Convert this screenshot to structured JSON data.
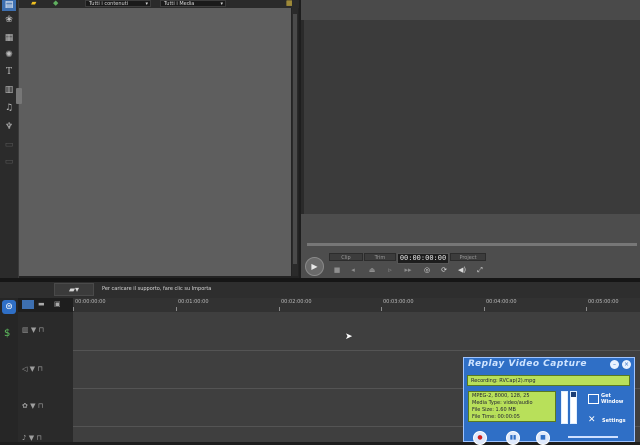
{
  "library": {
    "filter_contents": "Tutti i contenuti",
    "filter_media": "Tutti i Media"
  },
  "preview": {
    "field_left": "Clip",
    "field_mid": "Trim",
    "timecode": "00:00:00:00",
    "field_right": "Project"
  },
  "toolbar": {
    "hint": "Per caricare il supporto, fare clic su Importa"
  },
  "timeline": {
    "ruler": [
      "00:00:00:00",
      "00:01:00:00",
      "00:02:00:00",
      "00:03:00:00",
      "00:04:00:00",
      "00:05:00:00"
    ]
  },
  "capture": {
    "title": "Replay Video Capture",
    "recording": "Recording: RVCap(2).mpg",
    "info": [
      "MPEG-2, 8000, 128, 25",
      "Media Type: video/audio",
      "File Size: 1.60 MB",
      "File Time: 00:00:05"
    ],
    "get_window": "Get Window",
    "settings": "Settings",
    "meter_levels": [
      1.0,
      0.85
    ]
  },
  "colors": {
    "capture_bg": "#2f6fc6",
    "capture_lcd": "#b8e05a"
  },
  "icons": [
    "film-icon",
    "transition-icon",
    "effect-icon",
    "title-icon",
    "overlay-icon",
    "audio-icon",
    "mic-icon",
    "play-icon",
    "folder-icon",
    "cursor-icon"
  ]
}
